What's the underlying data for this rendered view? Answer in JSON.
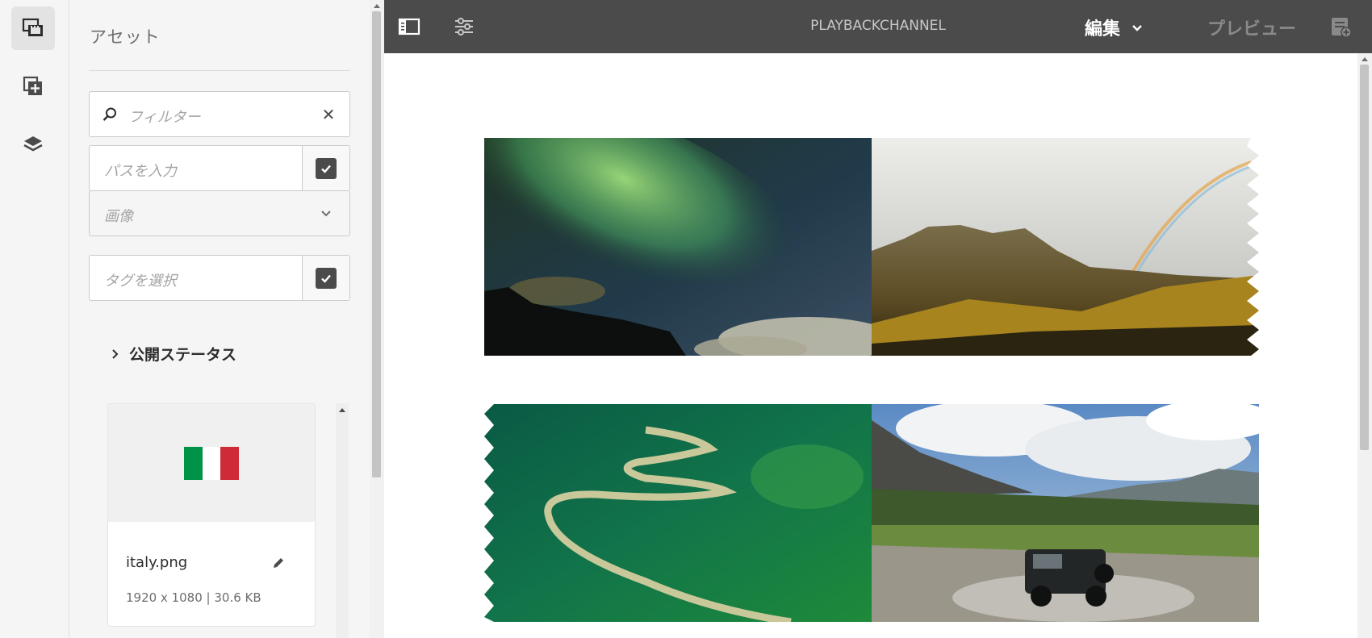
{
  "rail": {
    "items": [
      {
        "name": "assets-icon",
        "active": true
      },
      {
        "name": "components-icon",
        "active": false
      },
      {
        "name": "layers-icon",
        "active": false
      }
    ]
  },
  "panel": {
    "title": "アセット",
    "filter": {
      "placeholder": "フィルター"
    },
    "path": {
      "placeholder": "パスを入力"
    },
    "type_select": {
      "value": "画像"
    },
    "tags": {
      "placeholder": "タグを選択"
    },
    "publish_status": {
      "label": "公開ステータス"
    },
    "assets": [
      {
        "name": "italy.png",
        "meta": "1920 x 1080 | 30.6 KB",
        "flag_colors": [
          "#009246",
          "#ffffff",
          "#ce2b37"
        ]
      }
    ]
  },
  "topbar": {
    "title": "PLAYBACKCHANNEL",
    "mode_label": "編集",
    "preview_label": "プレビュー",
    "icons": [
      "side-panel-toggle-icon",
      "page-properties-icon",
      "page-info-icon"
    ],
    "colors": {
      "bar": "#4b4b4b",
      "mode_text": "#ffffff",
      "preview_text": "#8a8a8a"
    }
  },
  "canvas": {
    "images": [
      {
        "name": "aurora-image"
      },
      {
        "name": "mountain-rainbow-image"
      },
      {
        "name": "river-forest-image"
      },
      {
        "name": "offroad-car-image"
      }
    ]
  }
}
